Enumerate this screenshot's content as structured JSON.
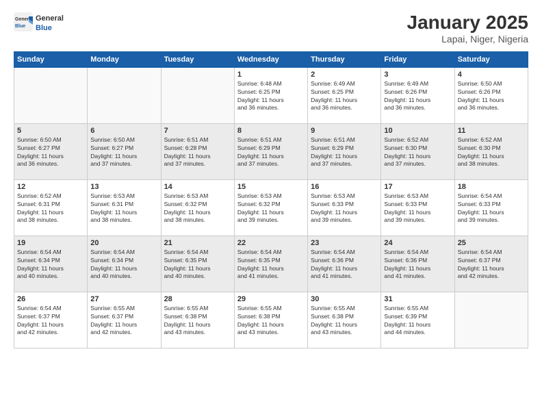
{
  "header": {
    "logo_general": "General",
    "logo_blue": "Blue",
    "title": "January 2025",
    "subtitle": "Lapai, Niger, Nigeria"
  },
  "days_of_week": [
    "Sunday",
    "Monday",
    "Tuesday",
    "Wednesday",
    "Thursday",
    "Friday",
    "Saturday"
  ],
  "weeks": [
    {
      "days": [
        {
          "num": "",
          "info": ""
        },
        {
          "num": "",
          "info": ""
        },
        {
          "num": "",
          "info": ""
        },
        {
          "num": "1",
          "info": "Sunrise: 6:48 AM\nSunset: 6:25 PM\nDaylight: 11 hours\nand 36 minutes."
        },
        {
          "num": "2",
          "info": "Sunrise: 6:49 AM\nSunset: 6:25 PM\nDaylight: 11 hours\nand 36 minutes."
        },
        {
          "num": "3",
          "info": "Sunrise: 6:49 AM\nSunset: 6:26 PM\nDaylight: 11 hours\nand 36 minutes."
        },
        {
          "num": "4",
          "info": "Sunrise: 6:50 AM\nSunset: 6:26 PM\nDaylight: 11 hours\nand 36 minutes."
        }
      ]
    },
    {
      "days": [
        {
          "num": "5",
          "info": "Sunrise: 6:50 AM\nSunset: 6:27 PM\nDaylight: 11 hours\nand 36 minutes."
        },
        {
          "num": "6",
          "info": "Sunrise: 6:50 AM\nSunset: 6:27 PM\nDaylight: 11 hours\nand 37 minutes."
        },
        {
          "num": "7",
          "info": "Sunrise: 6:51 AM\nSunset: 6:28 PM\nDaylight: 11 hours\nand 37 minutes."
        },
        {
          "num": "8",
          "info": "Sunrise: 6:51 AM\nSunset: 6:29 PM\nDaylight: 11 hours\nand 37 minutes."
        },
        {
          "num": "9",
          "info": "Sunrise: 6:51 AM\nSunset: 6:29 PM\nDaylight: 11 hours\nand 37 minutes."
        },
        {
          "num": "10",
          "info": "Sunrise: 6:52 AM\nSunset: 6:30 PM\nDaylight: 11 hours\nand 37 minutes."
        },
        {
          "num": "11",
          "info": "Sunrise: 6:52 AM\nSunset: 6:30 PM\nDaylight: 11 hours\nand 38 minutes."
        }
      ]
    },
    {
      "days": [
        {
          "num": "12",
          "info": "Sunrise: 6:52 AM\nSunset: 6:31 PM\nDaylight: 11 hours\nand 38 minutes."
        },
        {
          "num": "13",
          "info": "Sunrise: 6:53 AM\nSunset: 6:31 PM\nDaylight: 11 hours\nand 38 minutes."
        },
        {
          "num": "14",
          "info": "Sunrise: 6:53 AM\nSunset: 6:32 PM\nDaylight: 11 hours\nand 38 minutes."
        },
        {
          "num": "15",
          "info": "Sunrise: 6:53 AM\nSunset: 6:32 PM\nDaylight: 11 hours\nand 39 minutes."
        },
        {
          "num": "16",
          "info": "Sunrise: 6:53 AM\nSunset: 6:33 PM\nDaylight: 11 hours\nand 39 minutes."
        },
        {
          "num": "17",
          "info": "Sunrise: 6:53 AM\nSunset: 6:33 PM\nDaylight: 11 hours\nand 39 minutes."
        },
        {
          "num": "18",
          "info": "Sunrise: 6:54 AM\nSunset: 6:33 PM\nDaylight: 11 hours\nand 39 minutes."
        }
      ]
    },
    {
      "days": [
        {
          "num": "19",
          "info": "Sunrise: 6:54 AM\nSunset: 6:34 PM\nDaylight: 11 hours\nand 40 minutes."
        },
        {
          "num": "20",
          "info": "Sunrise: 6:54 AM\nSunset: 6:34 PM\nDaylight: 11 hours\nand 40 minutes."
        },
        {
          "num": "21",
          "info": "Sunrise: 6:54 AM\nSunset: 6:35 PM\nDaylight: 11 hours\nand 40 minutes."
        },
        {
          "num": "22",
          "info": "Sunrise: 6:54 AM\nSunset: 6:35 PM\nDaylight: 11 hours\nand 41 minutes."
        },
        {
          "num": "23",
          "info": "Sunrise: 6:54 AM\nSunset: 6:36 PM\nDaylight: 11 hours\nand 41 minutes."
        },
        {
          "num": "24",
          "info": "Sunrise: 6:54 AM\nSunset: 6:36 PM\nDaylight: 11 hours\nand 41 minutes."
        },
        {
          "num": "25",
          "info": "Sunrise: 6:54 AM\nSunset: 6:37 PM\nDaylight: 11 hours\nand 42 minutes."
        }
      ]
    },
    {
      "days": [
        {
          "num": "26",
          "info": "Sunrise: 6:54 AM\nSunset: 6:37 PM\nDaylight: 11 hours\nand 42 minutes."
        },
        {
          "num": "27",
          "info": "Sunrise: 6:55 AM\nSunset: 6:37 PM\nDaylight: 11 hours\nand 42 minutes."
        },
        {
          "num": "28",
          "info": "Sunrise: 6:55 AM\nSunset: 6:38 PM\nDaylight: 11 hours\nand 43 minutes."
        },
        {
          "num": "29",
          "info": "Sunrise: 6:55 AM\nSunset: 6:38 PM\nDaylight: 11 hours\nand 43 minutes."
        },
        {
          "num": "30",
          "info": "Sunrise: 6:55 AM\nSunset: 6:38 PM\nDaylight: 11 hours\nand 43 minutes."
        },
        {
          "num": "31",
          "info": "Sunrise: 6:55 AM\nSunset: 6:39 PM\nDaylight: 11 hours\nand 44 minutes."
        },
        {
          "num": "",
          "info": ""
        }
      ]
    }
  ]
}
